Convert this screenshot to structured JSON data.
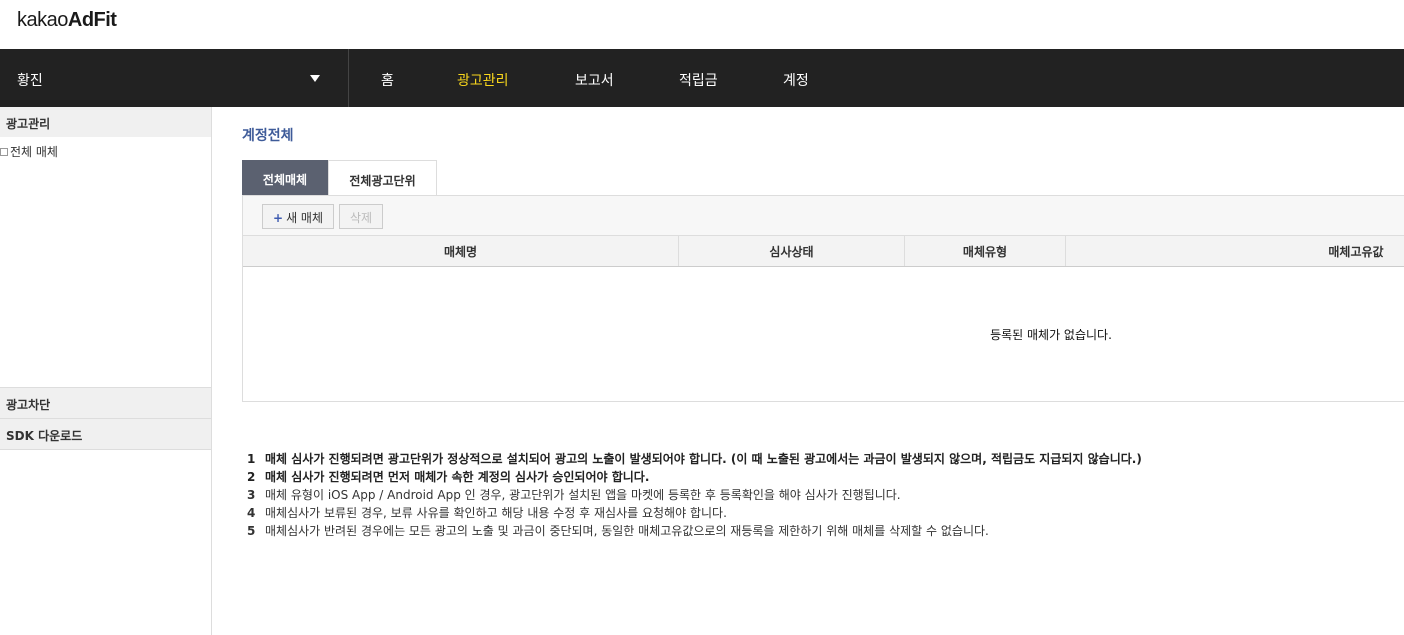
{
  "logo": {
    "prefix": "kakao",
    "brand": "AdFit"
  },
  "gnb": {
    "account": "황진",
    "items": [
      "홈",
      "광고관리",
      "보고서",
      "적립금",
      "계정"
    ],
    "active_index": 1
  },
  "sidebar": {
    "sections": [
      "광고관리",
      "광고차단",
      "SDK 다운로드"
    ],
    "tree_item": "전체 매체"
  },
  "main": {
    "title": "계정전체",
    "tabs": [
      "전체매체",
      "전체광고단위"
    ],
    "toolbar": {
      "new_plus": "+",
      "new_label": "새 매체",
      "delete_label": "삭제"
    },
    "columns": [
      "매체명",
      "심사상태",
      "매체유형",
      "매체고유값"
    ],
    "empty_message": "등록된 매체가 없습니다.",
    "notes": [
      {
        "num": "1",
        "text": "매체 심사가 진행되려면 광고단위가 정상적으로 설치되어 광고의 노출이 발생되어야 합니다. (이 때 노출된 광고에서는 과금이 발생되지 않으며, 적립금도 지급되지 않습니다.)"
      },
      {
        "num": "2",
        "text": "매체 심사가 진행되려면 먼저 매체가 속한 계정의 심사가 승인되어야 합니다."
      },
      {
        "num": "3",
        "text": "매체 유형이 iOS App / Android App 인 경우, 광고단위가 설치된 앱을 마켓에 등록한 후 등록확인을 해야 심사가 진행됩니다."
      },
      {
        "num": "4",
        "text": "매체심사가 보류된 경우, 보류 사유를 확인하고 해당 내용 수정 후 재심사를 요청해야 합니다."
      },
      {
        "num": "5",
        "text": "매체심사가 반려된 경우에는 모든 광고의 노출 및 과금이 중단되며, 동일한 매체고유값으로의 재등록을 제한하기 위해 매체를 삭제할 수 없습니다."
      }
    ]
  },
  "colors": {
    "gnb_bg": "#222222",
    "active_nav": "#f9d71c",
    "title_blue": "#3e5b99",
    "tab_active": "#5b6170"
  }
}
